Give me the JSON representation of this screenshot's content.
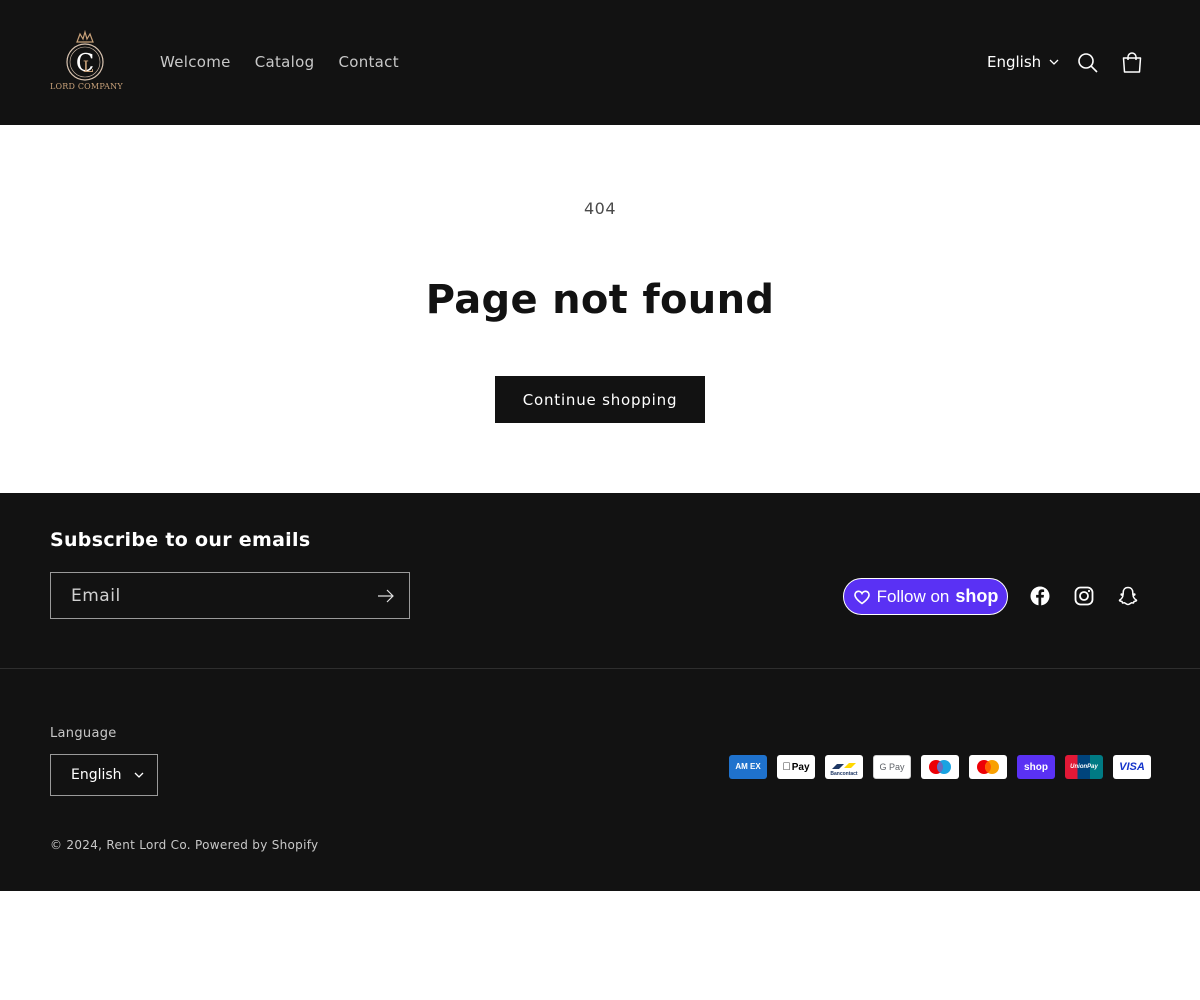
{
  "header": {
    "logo_text": "LORD COMPANY",
    "nav": [
      {
        "label": "Welcome"
      },
      {
        "label": "Catalog"
      },
      {
        "label": "Contact"
      }
    ],
    "language": "English",
    "icons": [
      "search-icon",
      "cart-icon",
      "chevron-down-icon"
    ]
  },
  "main": {
    "code": "404",
    "title": "Page not found",
    "cta_label": "Continue shopping"
  },
  "footer": {
    "subscribe_title": "Subscribe to our emails",
    "email_placeholder": "Email",
    "shop_follow_prefix": "Follow on",
    "shop_follow_brand": "shop",
    "social_icons": [
      "facebook-icon",
      "instagram-icon",
      "snapchat-icon"
    ],
    "language_label": "Language",
    "language_value": "English",
    "payment_methods": [
      {
        "name": "American Express",
        "text": "AM EX"
      },
      {
        "name": "Apple Pay",
        "text": "Pay"
      },
      {
        "name": "Bancontact",
        "text": "Bancontact"
      },
      {
        "name": "Google Pay",
        "text": "G Pay"
      },
      {
        "name": "Maestro",
        "text": ""
      },
      {
        "name": "Mastercard",
        "text": ""
      },
      {
        "name": "Shop Pay",
        "text": "shop"
      },
      {
        "name": "Union Pay",
        "text": "UnionPay"
      },
      {
        "name": "Visa",
        "text": "VISA"
      }
    ],
    "copyright_prefix": "© 2024,",
    "store_name": "Rent Lord Co.",
    "powered_by": "Powered by Shopify"
  },
  "colors": {
    "dark_bg": "#121212",
    "shop_purple": "#5a31f4",
    "logo_gold": "#c9a27a"
  }
}
